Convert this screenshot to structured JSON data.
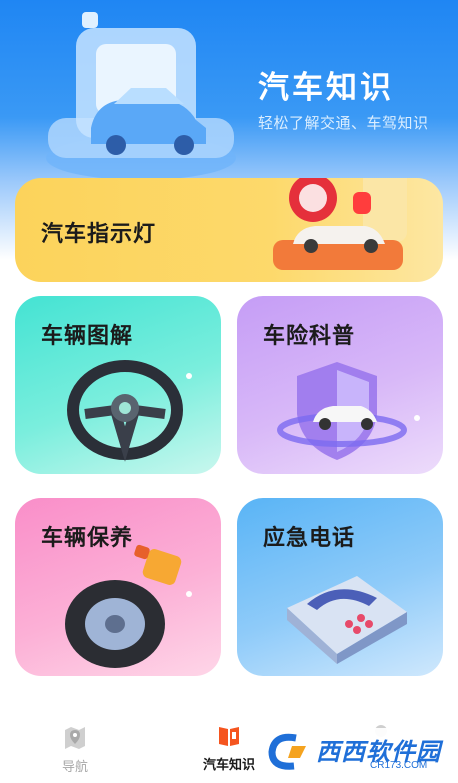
{
  "header": {
    "title": "汽车知识",
    "subtitle": "轻松了解交通、车驾知识"
  },
  "cards": [
    {
      "label": "汽车指示灯",
      "icon": "warning-light-icon",
      "color": "#fcd35b"
    },
    {
      "label": "车辆图解",
      "icon": "steering-wheel-icon",
      "color": "#44e3d3"
    },
    {
      "label": "车险科普",
      "icon": "shield-car-icon",
      "color": "#c59df6"
    },
    {
      "label": "车辆保养",
      "icon": "tire-icon",
      "color": "#f98ec9"
    },
    {
      "label": "应急电话",
      "icon": "telephone-icon",
      "color": "#59b4f6"
    }
  ],
  "bottom_nav": {
    "items": [
      {
        "label": "导航",
        "icon": "map-pin-icon",
        "active": false
      },
      {
        "label": "汽车知识",
        "icon": "book-icon",
        "active": true
      },
      {
        "label": "",
        "icon": "user-icon",
        "active": false
      }
    ]
  },
  "watermark": {
    "text": "西西软件园",
    "url": "CR173.COM"
  },
  "colors": {
    "accent": "#1f86f3",
    "active_nav_icon": "#f5551f"
  }
}
